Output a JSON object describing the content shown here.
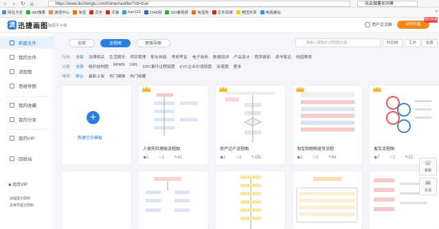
{
  "browser": {
    "url": "https://www.liuchengtu.com/home/newfile/?ctt=true",
    "search": "张启烟蔓如词萧",
    "bookmarks": [
      {
        "label": "网址大全",
        "color": "#4a90d9"
      },
      {
        "label": "360搜索",
        "color": "#2fa84f"
      },
      {
        "label": "游戏中心",
        "color": "#e84"
      },
      {
        "label": "淘宝",
        "color": "#f60"
      },
      {
        "label": "京东",
        "color": "#d22"
      },
      {
        "label": "天猫",
        "color": "#d22"
      },
      {
        "label": "hao123",
        "color": "#39f"
      },
      {
        "label": "2345网",
        "color": "#36c"
      },
      {
        "label": "360看视频",
        "color": "#2fa84f"
      },
      {
        "label": "淘宝网",
        "color": "#f60"
      },
      {
        "label": "京东商城",
        "color": "#d22"
      },
      {
        "label": "美团外卖",
        "color": "#fc0"
      },
      {
        "label": "电商建站",
        "color": "#39f"
      }
    ],
    "more": "»"
  },
  "app": {
    "logo_mark": "流",
    "logo_text": "迅捷画图",
    "tagline": "脑图不卡顿",
    "user": "用户交流群",
    "vip_button": "VIP升级",
    "hot": "限时特惠"
  },
  "sidebar": {
    "items": [
      {
        "label": "新建文件",
        "active": true
      },
      {
        "label": "我的文件",
        "active": false
      },
      {
        "label": "流程图",
        "active": false
      },
      {
        "label": "思维导图",
        "active": false
      },
      {
        "label": "我的收藏",
        "active": false
      },
      {
        "label": "我的分享",
        "active": false
      },
      {
        "label": "我的VIP",
        "active": false
      },
      {
        "label": "回收站",
        "active": false
      }
    ],
    "vip_title": "组合VIP",
    "vip_subs": [
      "流程图无限制",
      "思维导图无限制"
    ]
  },
  "tabs": [
    "全部",
    "流程图",
    "思维导图"
  ],
  "search_placeholder": "请输入搜索的流程图内容",
  "chips": [
    "时间线",
    "工作",
    "检索"
  ],
  "filters": {
    "industry": {
      "label": "行业:",
      "items": [
        "全部",
        "法律相关",
        "生活娱乐",
        "项目管理",
        "职业技能",
        "考研考证",
        "电子商务",
        "数据培训",
        "产品设计",
        "程序维拓",
        "读书笔记",
        "校园教育"
      ]
    },
    "type": {
      "label": "分类:",
      "items": [
        "全部",
        "组织结构图",
        "BPMN",
        "UML",
        "EPC事件过程链图",
        "EVC企业价值链图",
        "泳道图",
        "更多"
      ]
    },
    "sort": {
      "label": "排序:",
      "items": [
        "默认",
        "最新上架",
        "热门编辑",
        "热门收藏"
      ]
    }
  },
  "new_card_label": "新建空白模板",
  "cards": [
    {
      "title": "人保失险理赔流程图",
      "views": "1",
      "likes": "1",
      "edits": "41"
    },
    {
      "title": "房产过户流程图",
      "views": "1",
      "likes": "1",
      "edits": "101"
    },
    {
      "title": "淘宝购物物退货流程",
      "views": "2",
      "likes": "2",
      "edits": "94"
    },
    {
      "title": "客车流程图",
      "views": "7",
      "likes": "2",
      "edits": "22"
    }
  ],
  "fab": [
    "客服",
    "反馈"
  ]
}
